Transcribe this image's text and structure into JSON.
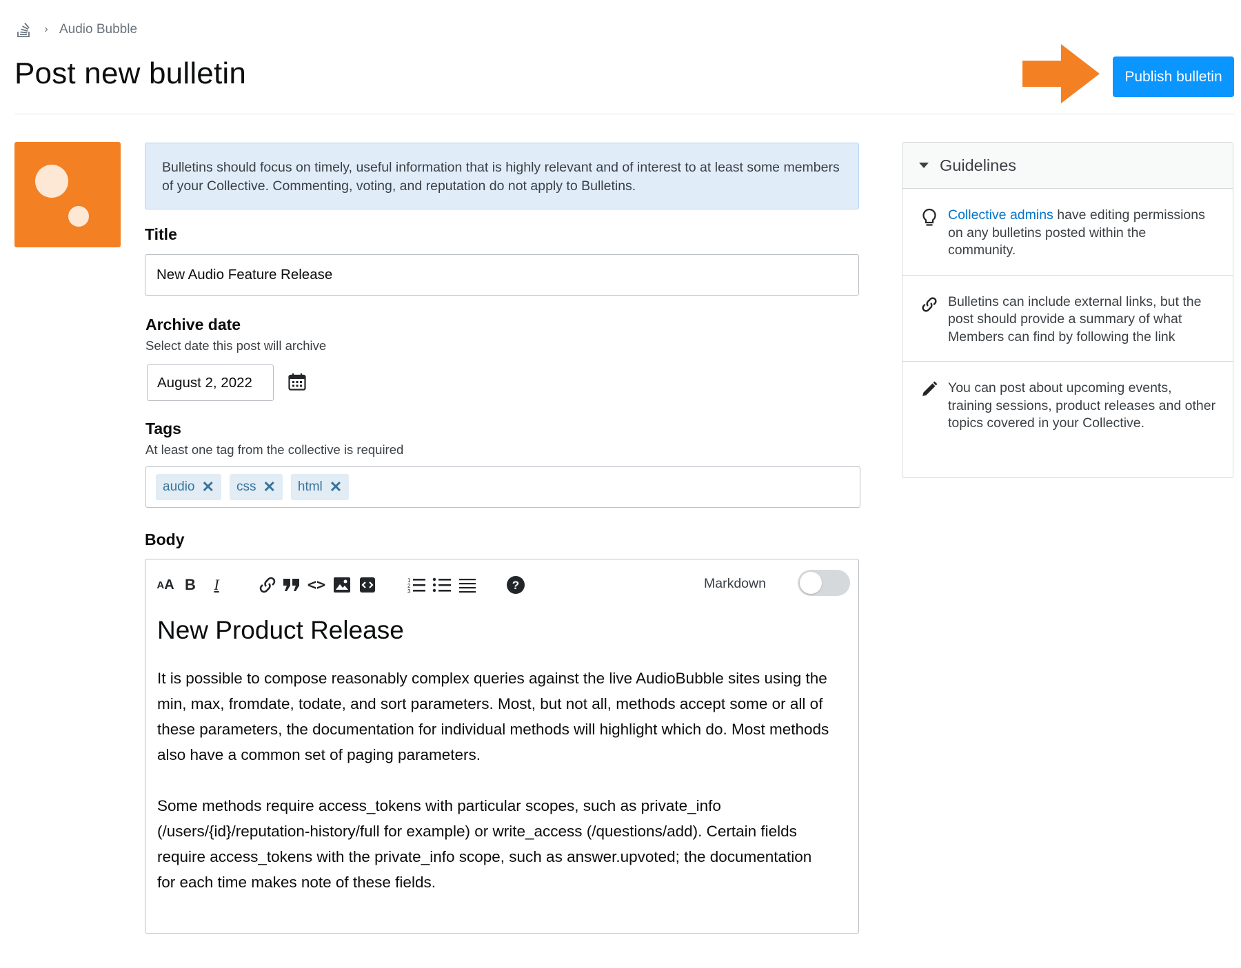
{
  "breadcrumb": {
    "logo_icon": "stack-overflow-logo-icon",
    "separator_icon": "chevron-right-icon",
    "current": "Audio Bubble"
  },
  "header": {
    "title": "Post new bulletin",
    "publish_label": "Publish bulletin",
    "arrow_color": "#f48024",
    "accent_color": "#0a95ff"
  },
  "avatar": {
    "color": "#f48024"
  },
  "notice": {
    "text": "Bulletins should focus on timely, useful information that is highly relevant and of interest to at least some members of your Collective. Commenting, voting, and reputation do not apply to Bulletins."
  },
  "title_field": {
    "label": "Title",
    "value": "New Audio Feature Release"
  },
  "archive": {
    "label": "Archive date",
    "hint": "Select date this post will archive",
    "value": "August 2, 2022",
    "icon": "calendar-icon"
  },
  "tags": {
    "label": "Tags",
    "hint": "At least one tag from the collective is required",
    "items": [
      {
        "name": "audio"
      },
      {
        "name": "css"
      },
      {
        "name": "html"
      }
    ]
  },
  "body": {
    "label": "Body",
    "toolbar": {
      "icons": [
        "heading-icon",
        "bold-icon",
        "italic-icon",
        "link-icon",
        "blockquote-icon",
        "code-icon",
        "image-icon",
        "snippet-icon",
        "numbered-list-icon",
        "bulleted-list-icon",
        "horizontal-rule-icon",
        "help-icon"
      ],
      "markdown_label": "Markdown",
      "markdown_enabled": false
    },
    "heading": "New Product Release",
    "paragraphs": [
      "It is possible to compose reasonably complex queries against the live AudioBubble sites using the min, max, fromdate, todate, and sort parameters. Most, but not all, methods accept some or all of these parameters, the documentation for individual methods will highlight which do. Most methods also have a common set of paging parameters.",
      "Some methods require access_tokens with particular scopes, such as private_info (/users/{id}/reputation-history/full for example) or write_access (/questions/add). Certain fields require access_tokens with the private_info scope, such as answer.upvoted; the documentation for each time makes note of these fields."
    ]
  },
  "sidebar": {
    "heading": "Guidelines",
    "items": [
      {
        "icon": "lightbulb-icon",
        "link": "Collective admins",
        "text": " have editing permissions on any bulletins posted within the community."
      },
      {
        "icon": "link-icon",
        "text": "Bulletins can include external links, but the post should provide a summary of what Members can find by following the link"
      },
      {
        "icon": "pencil-icon",
        "text": "You can post about upcoming events, training sessions, product releases and other topics covered in your Collective."
      }
    ]
  }
}
